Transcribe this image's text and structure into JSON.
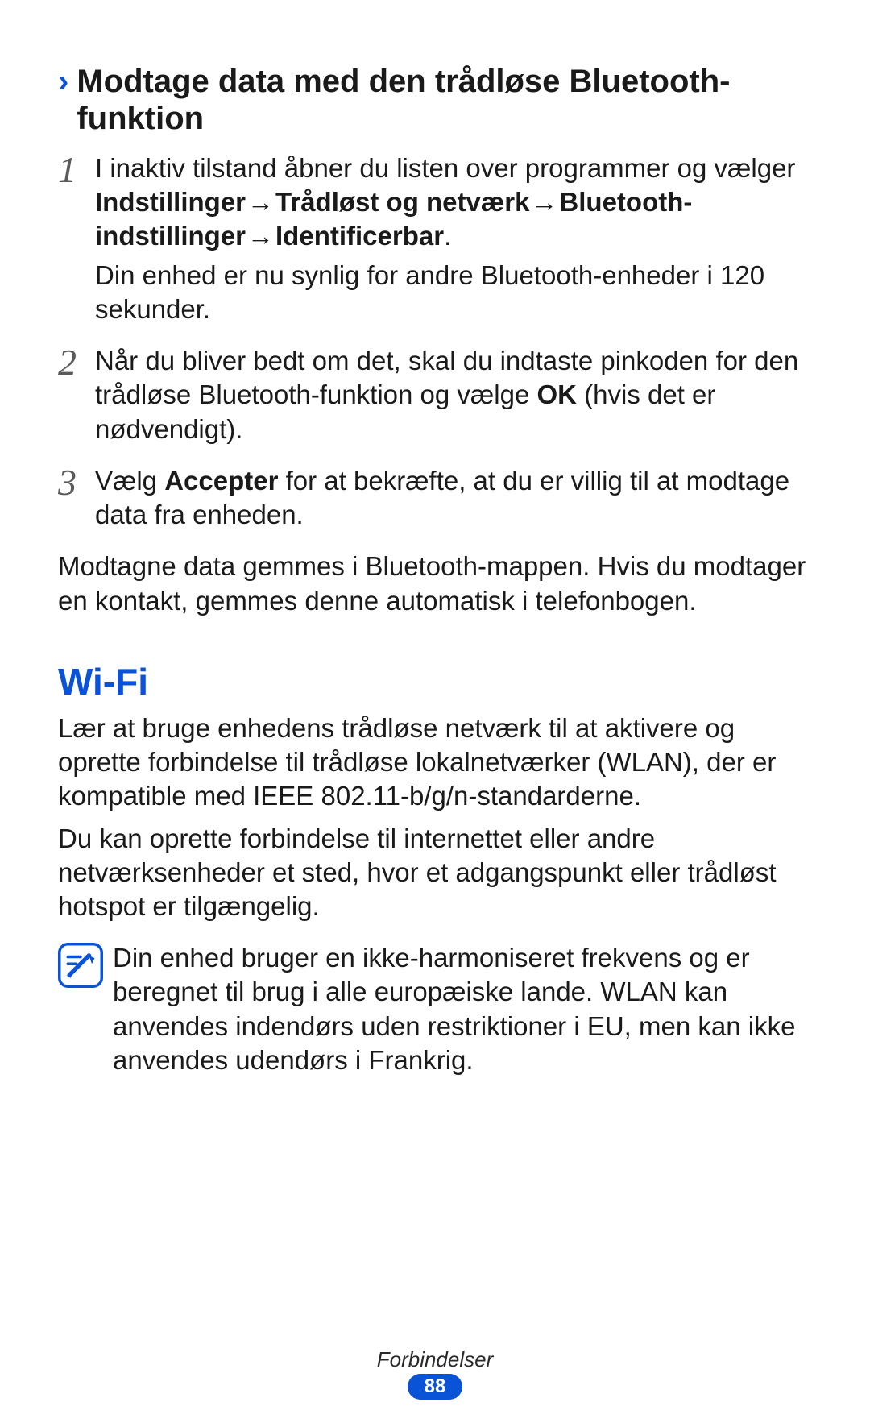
{
  "section1": {
    "heading": "Modtage data med den trådløse Bluetooth-funktion",
    "steps": [
      {
        "num": "1",
        "intro": "I inaktiv tilstand åbner du listen over programmer og vælger ",
        "bold1": "Indstillinger",
        "arrow1": " → ",
        "bold2": "Trådløst og netværk",
        "arrow2": " → ",
        "bold3": "Bluetooth-indstillinger",
        "arrow3": " → ",
        "bold4": "Identificerbar",
        "period": ".",
        "sub": "Din enhed er nu synlig for andre Bluetooth-enheder i 120 sekunder."
      },
      {
        "num": "2",
        "text_a": "Når du bliver bedt om det, skal du indtaste pinkoden for den trådløse Bluetooth-funktion og vælge ",
        "bold": "OK",
        "text_b": " (hvis det er nødvendigt)."
      },
      {
        "num": "3",
        "text_a": "Vælg ",
        "bold": "Accepter",
        "text_b": " for at bekræfte, at du er villig til at modtage data fra enheden."
      }
    ],
    "closing": "Modtagne data gemmes i Bluetooth-mappen. Hvis du modtager en kontakt, gemmes denne automatisk i telefonbogen."
  },
  "section2": {
    "heading": "Wi-Fi",
    "para1": "Lær at bruge enhedens trådløse netværk til at aktivere og oprette forbindelse til trådløse lokalnetværker (WLAN), der er kompatible med IEEE 802.11-b/g/n-standarderne.",
    "para2": "Du kan oprette forbindelse til internettet eller andre netværksenheder et sted, hvor et adgangspunkt eller trådløst hotspot er tilgængelig.",
    "note": "Din enhed bruger en ikke-harmoniseret frekvens og er beregnet til brug i alle europæiske lande. WLAN kan anvendes indendørs uden restriktioner i EU, men kan ikke anvendes udendørs i Frankrig."
  },
  "footer": {
    "label": "Forbindelser",
    "page": "88"
  }
}
